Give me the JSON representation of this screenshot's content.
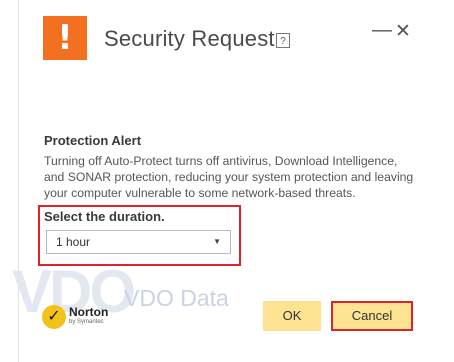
{
  "dialog": {
    "title": "Security Request",
    "help_symbol": "?",
    "minimize_symbol": "—",
    "close_symbol": "✕",
    "alert_symbol": "!"
  },
  "content": {
    "heading": "Protection Alert",
    "body": "Turning off Auto-Protect turns off antivirus, Download Intelligence, and SONAR protection, reducing your system protection and leaving your computer vulnerable to some network-based threats.",
    "duration_label": "Select the duration.",
    "duration_selected": "1 hour"
  },
  "branding": {
    "norton_word": "Norton",
    "norton_sub": "by Symantec",
    "watermark_text": "VDO Data",
    "watermark_logo": "VDO"
  },
  "buttons": {
    "ok_label": "OK",
    "cancel_label": "Cancel"
  },
  "colors": {
    "alert_orange": "#f37021",
    "button_yellow": "#fbe392",
    "highlight_red": "#d9262c"
  },
  "icons": {
    "alert": "exclamation-icon",
    "help": "help-icon",
    "minimize": "minimize-icon",
    "close": "close-icon",
    "dropdown": "chevron-down-icon",
    "norton": "norton-check-icon"
  }
}
